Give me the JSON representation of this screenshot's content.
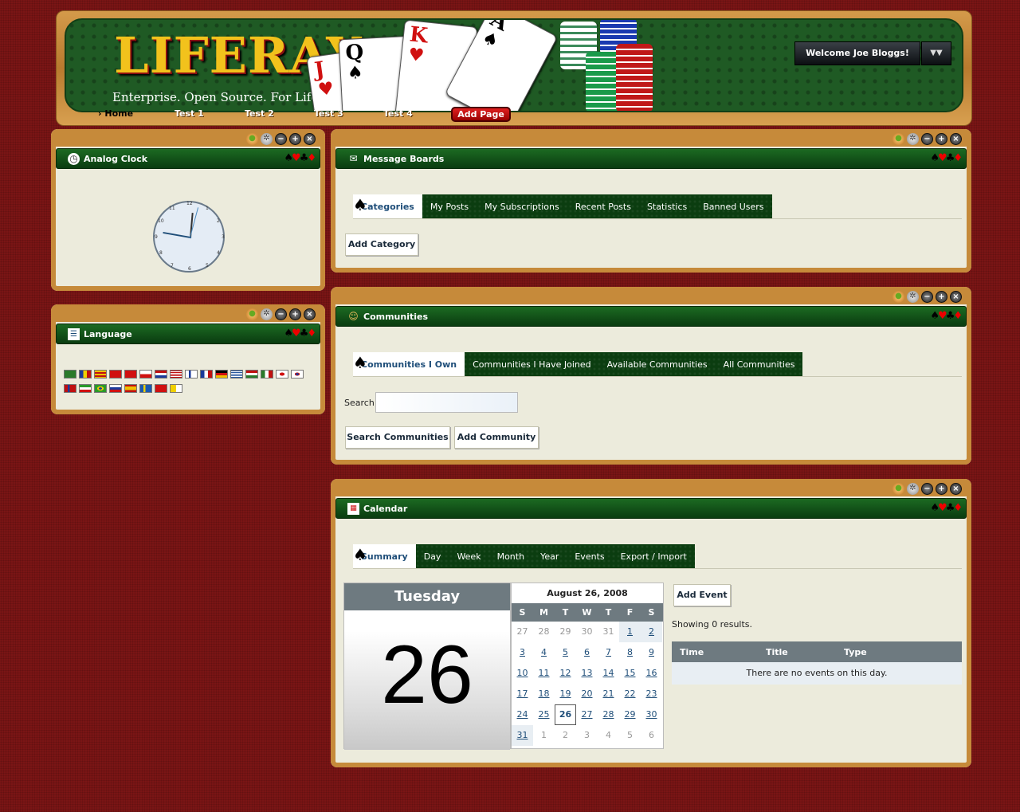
{
  "header": {
    "logo": "LIFERAY",
    "tagline": "Enterprise. Open Source. For Life.",
    "welcome": "Welcome Joe Bloggs!",
    "nav": [
      {
        "label": "Home"
      },
      {
        "label": "Test 1"
      },
      {
        "label": "Test 2"
      },
      {
        "label": "Test 3"
      },
      {
        "label": "Test 4"
      }
    ],
    "add_page": "Add Page",
    "cards": [
      "J",
      "Q",
      "K",
      "A"
    ]
  },
  "clock": {
    "title": "Analog Clock"
  },
  "language": {
    "title": "Language"
  },
  "message_boards": {
    "title": "Message Boards",
    "tabs": [
      "Categories",
      "My Posts",
      "My Subscriptions",
      "Recent Posts",
      "Statistics",
      "Banned Users"
    ],
    "add_category": "Add Category"
  },
  "communities": {
    "title": "Communities",
    "tabs": [
      "Communities I Own",
      "Communities I Have Joined",
      "Available Communities",
      "All Communities"
    ],
    "search_label": "Search",
    "search_value": "",
    "search_button": "Search Communities",
    "add_button": "Add Community"
  },
  "calendar": {
    "title": "Calendar",
    "tabs": [
      "Summary",
      "Day",
      "Week",
      "Month",
      "Year",
      "Events",
      "Export / Import"
    ],
    "day_name": "Tuesday",
    "day_number": "26",
    "month_title": "August 26, 2008",
    "weekdays": [
      "S",
      "M",
      "T",
      "W",
      "T",
      "F",
      "S"
    ],
    "weeks": [
      [
        "27",
        "28",
        "29",
        "30",
        "31",
        "1",
        "2"
      ],
      [
        "3",
        "4",
        "5",
        "6",
        "7",
        "8",
        "9"
      ],
      [
        "10",
        "11",
        "12",
        "13",
        "14",
        "15",
        "16"
      ],
      [
        "17",
        "18",
        "19",
        "20",
        "21",
        "22",
        "23"
      ],
      [
        "24",
        "25",
        "26",
        "27",
        "28",
        "29",
        "30"
      ],
      [
        "31",
        "1",
        "2",
        "3",
        "4",
        "5",
        "6"
      ]
    ],
    "add_event": "Add Event",
    "showing": "Showing 0 results.",
    "columns": [
      "Time",
      "Title",
      "Type"
    ],
    "empty": "There are no events on this day."
  }
}
